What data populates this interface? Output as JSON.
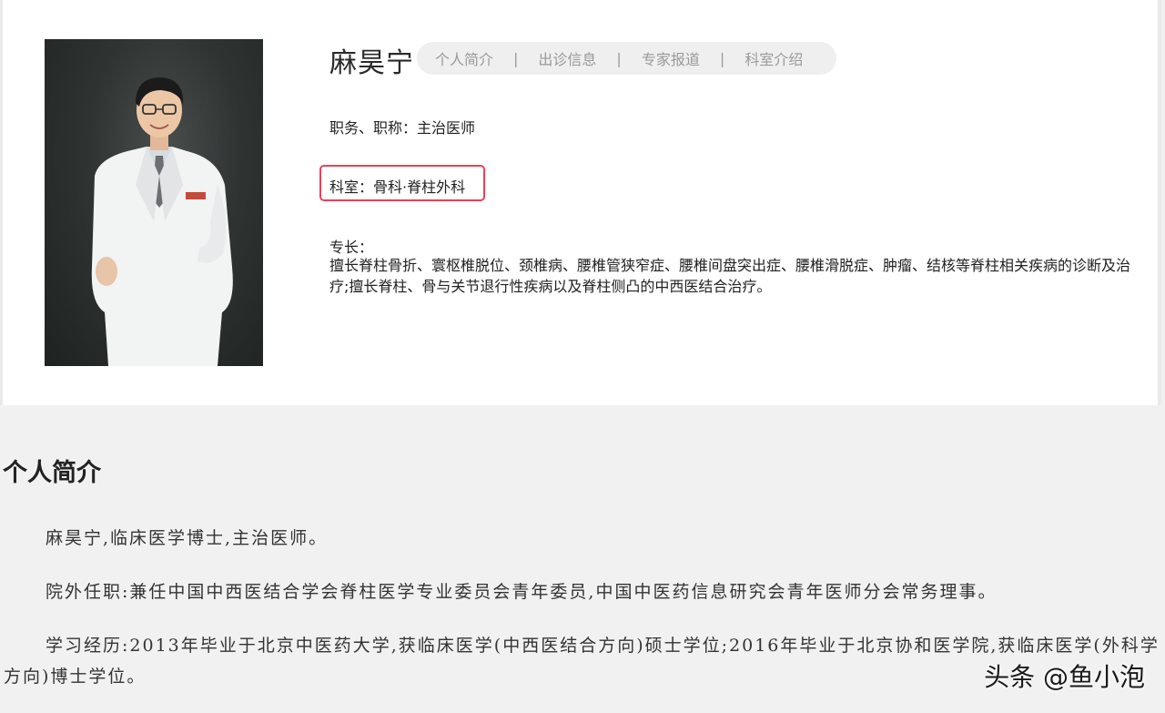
{
  "doctor": {
    "name": "麻昊宁",
    "title_line": "职务、职称：主治医师",
    "dept_line": "科室：骨科·脊柱外科",
    "specialty_label": "专长：",
    "specialty_text": "擅长脊柱骨折、寰枢椎脱位、颈椎病、腰椎管狭窄症、腰椎间盘突出症、腰椎滑脱症、肿瘤、结核等脊柱相关疾病的诊断及治疗;擅长脊柱、骨与关节退行性疾病以及脊柱侧凸的中西医结合治疗。"
  },
  "nav": {
    "items": [
      "个人简介",
      "出诊信息",
      "专家报道",
      "科室介绍"
    ],
    "separator": "|"
  },
  "bio": {
    "heading": "个人简介",
    "paragraphs": [
      "麻昊宁,临床医学博士,主治医师。",
      "院外任职:兼任中国中西医结合学会脊柱医学专业委员会青年委员,中国中医药信息研究会青年医师分会常务理事。",
      "学习经历:2013年毕业于北京中医药大学,获临床医学(中西医结合方向)硕士学位;2016年毕业于北京协和医学院,获临床医学(外科学方向)博士学位。"
    ]
  },
  "watermark": "头条 @鱼小泡",
  "colors": {
    "highlight_box": "#e8415a",
    "nav_bg": "#efefef",
    "nav_text": "#9a9a9a"
  }
}
